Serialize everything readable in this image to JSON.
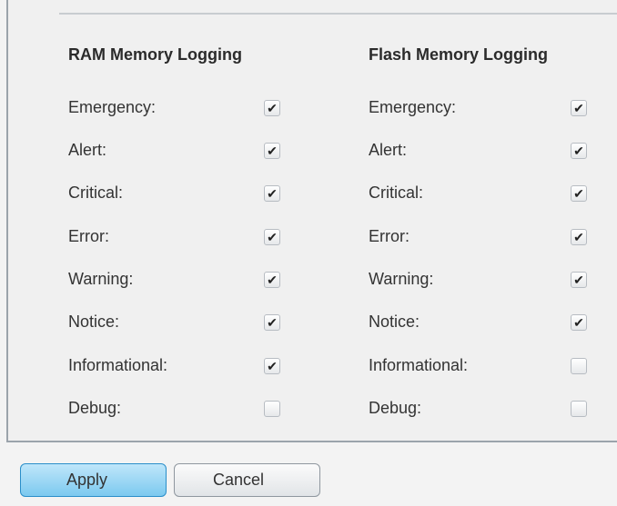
{
  "ram": {
    "heading": "RAM Memory Logging",
    "rows": [
      {
        "label": "Emergency:",
        "checked": true
      },
      {
        "label": "Alert:",
        "checked": true
      },
      {
        "label": "Critical:",
        "checked": true
      },
      {
        "label": "Error:",
        "checked": true
      },
      {
        "label": "Warning:",
        "checked": true
      },
      {
        "label": "Notice:",
        "checked": true
      },
      {
        "label": "Informational:",
        "checked": true
      },
      {
        "label": "Debug:",
        "checked": false
      }
    ]
  },
  "flash": {
    "heading": "Flash Memory Logging",
    "rows": [
      {
        "label": "Emergency:",
        "checked": true
      },
      {
        "label": "Alert:",
        "checked": true
      },
      {
        "label": "Critical:",
        "checked": true
      },
      {
        "label": "Error:",
        "checked": true
      },
      {
        "label": "Warning:",
        "checked": true
      },
      {
        "label": "Notice:",
        "checked": true
      },
      {
        "label": "Informational:",
        "checked": false
      },
      {
        "label": "Debug:",
        "checked": false
      }
    ]
  },
  "buttons": {
    "apply_label": "Apply",
    "cancel_label": "Cancel"
  },
  "colors": {
    "apply_border": "#2a8ec9",
    "apply_fill": "#7cc9ef",
    "panel_border": "#9ba3ab"
  }
}
